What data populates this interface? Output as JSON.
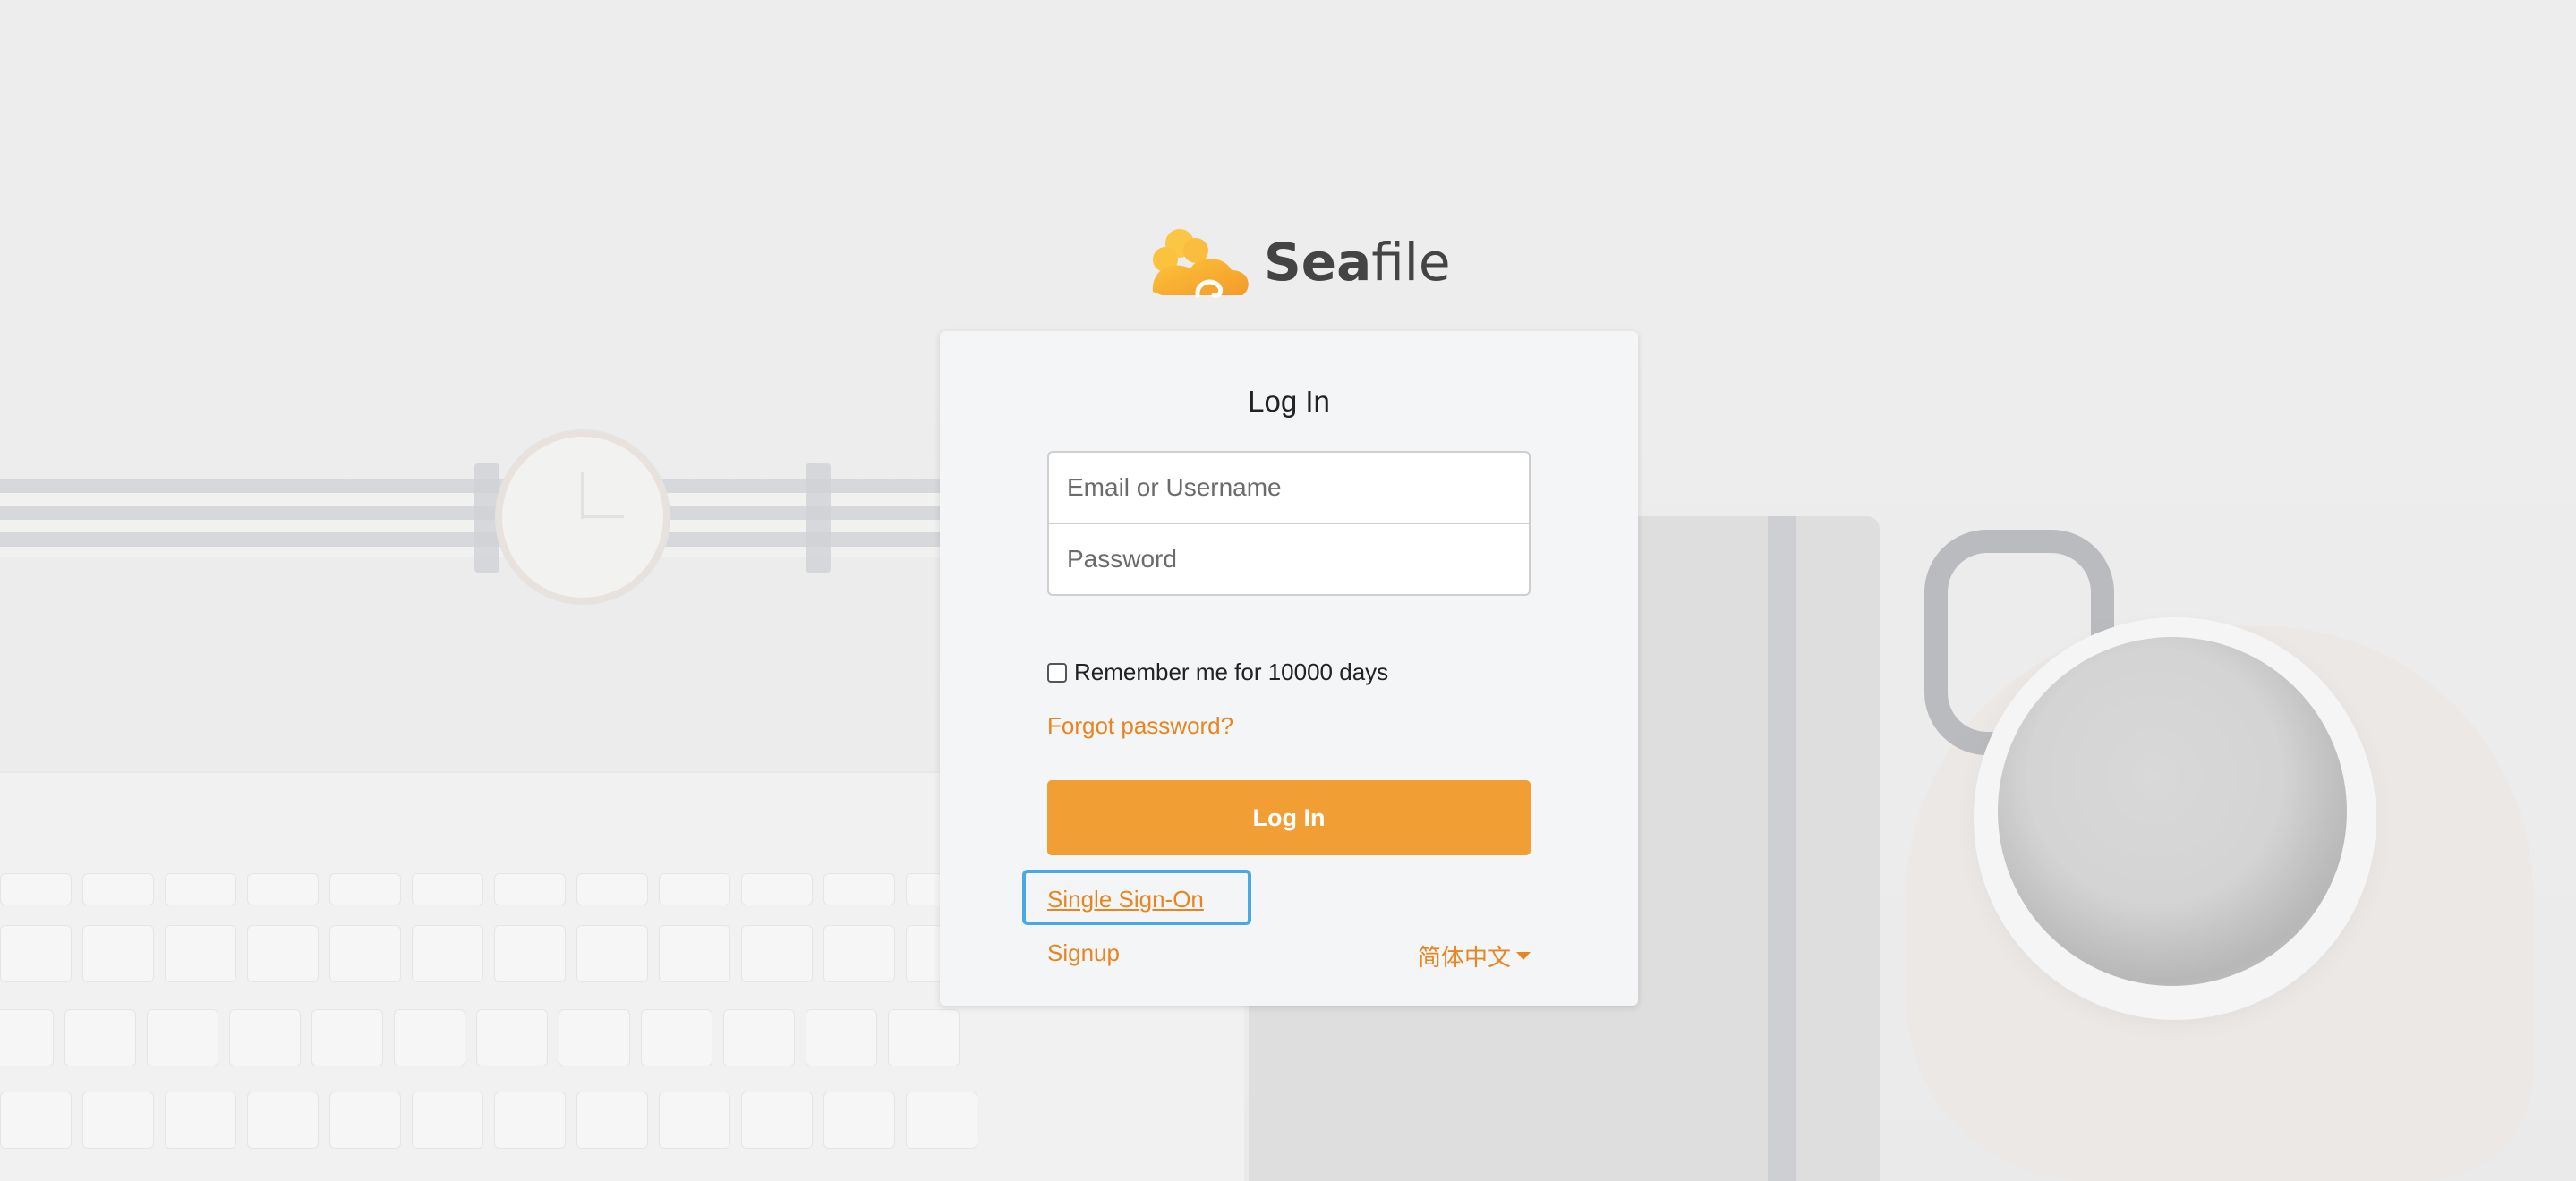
{
  "brand": {
    "name_bold": "Sea",
    "name_light": "file"
  },
  "login": {
    "title": "Log In",
    "username_placeholder": "Email or Username",
    "password_placeholder": "Password",
    "remember_label": "Remember me for 10000 days",
    "remember_checked": false,
    "forgot_label": "Forgot password?",
    "submit_label": "Log In",
    "sso_label": "Single Sign-On",
    "signup_label": "Signup",
    "language_label": "简体中文"
  },
  "colors": {
    "accent": "#f19e34",
    "link": "#e8851f",
    "focus_ring": "#48a9e6"
  },
  "icons": {
    "logo": "seafile-cloud-logo",
    "language_caret": "caret-down-icon"
  }
}
